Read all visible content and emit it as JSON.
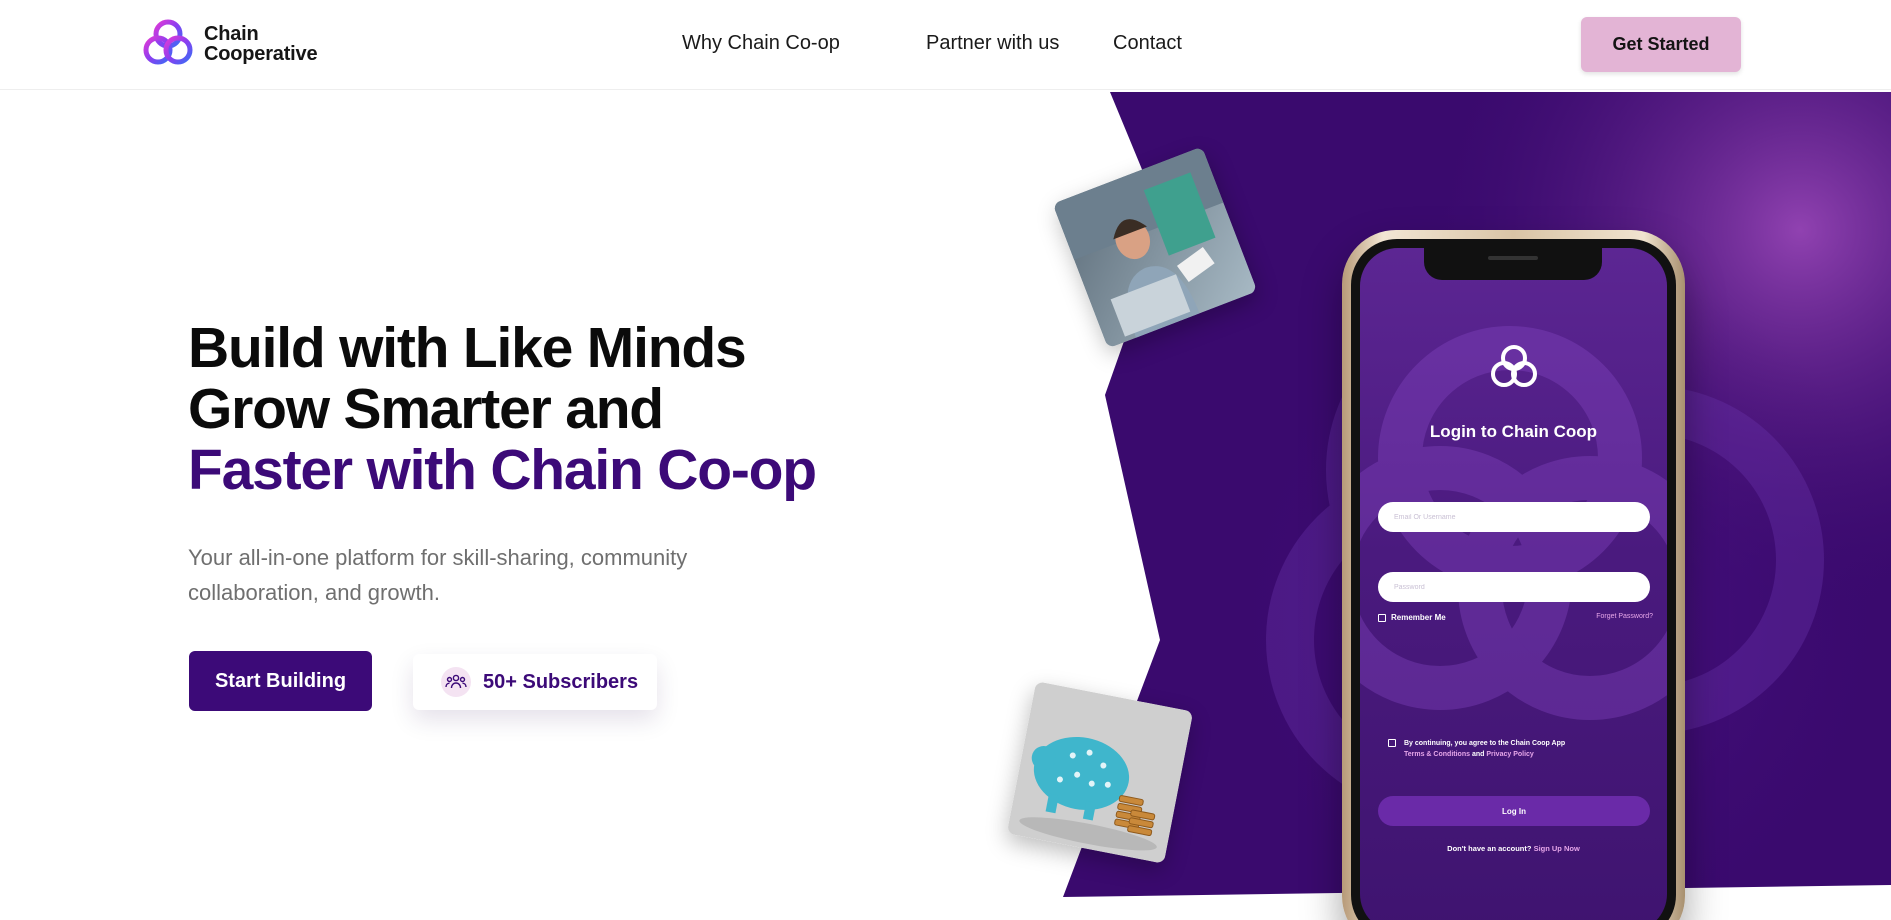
{
  "nav": {
    "logo_line1": "Chain",
    "logo_line2": "Cooperative",
    "links": [
      "Why Chain Co-op",
      "Partner with us",
      "Contact"
    ],
    "cta": "Get Started"
  },
  "hero": {
    "title_line1": "Build with Like Minds",
    "title_line2": "Grow Smarter and",
    "title_line3": "Faster with Chain Co-op",
    "subtitle": "Your all-in-one platform for skill-sharing, community collaboration, and growth.",
    "primary_button": "Start Building",
    "subscribers": "50+ Subscribers"
  },
  "phone": {
    "title": "Login to Chain Coop",
    "username_placeholder": "Email Or Username",
    "password_placeholder": "Password",
    "remember_me": "Remember Me",
    "forgot_password": "Forget Password?",
    "agree_text": "By continuing, you agree to the Chain Coop App",
    "terms": "Terms & Conditions",
    "and": "and",
    "privacy": "Privacy Policy",
    "login_button": "Log In",
    "no_account": "Don't have an account?",
    "sign_up": "Sign Up Now"
  },
  "colors": {
    "brand_purple": "#3c0a78",
    "hero_bg_purple": "#3a0a6e",
    "cta_pink": "#e3b4d5",
    "link_pink": "#e6a6e9"
  },
  "icons": [
    "chain-cooperative-logo-icon",
    "subscribers-group-icon",
    "checkbox-icon"
  ]
}
